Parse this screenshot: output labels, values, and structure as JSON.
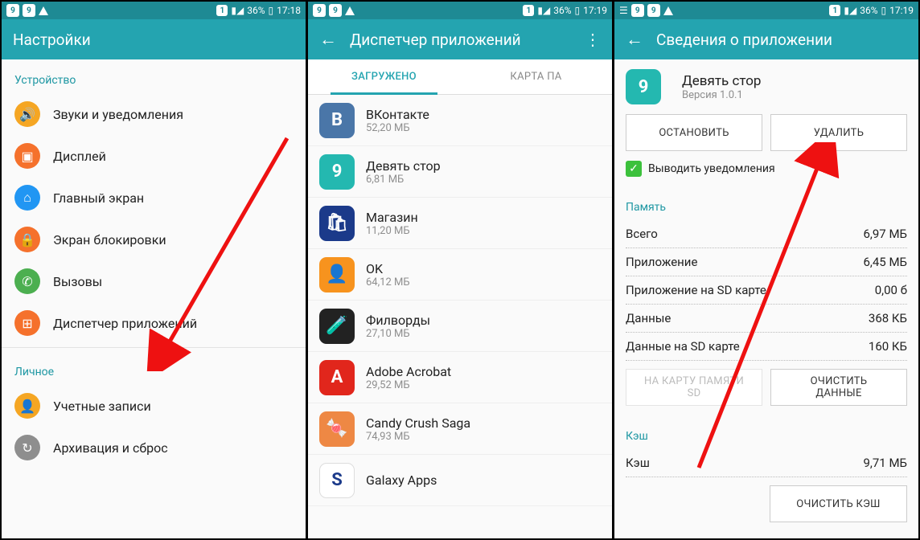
{
  "statusbar": {
    "battery": "36%",
    "time1": "17:18",
    "time2": "17:19",
    "time3": "17:19",
    "sim_badge": "1"
  },
  "screen1": {
    "title": "Настройки",
    "section_device": "Устройство",
    "items_device": [
      {
        "label": "Звуки и уведомления",
        "color": "#f5a623",
        "glyph": "🔊"
      },
      {
        "label": "Дисплей",
        "color": "#f5712c",
        "glyph": "▣"
      },
      {
        "label": "Главный экран",
        "color": "#2196f3",
        "glyph": "⌂"
      },
      {
        "label": "Экран блокировки",
        "color": "#f5712c",
        "glyph": "🔒"
      },
      {
        "label": "Вызовы",
        "color": "#4caf50",
        "glyph": "✆"
      },
      {
        "label": "Диспетчер приложений",
        "color": "#f5712c",
        "glyph": "⊞"
      }
    ],
    "section_personal": "Личное",
    "items_personal": [
      {
        "label": "Учетные записи",
        "color": "#f5a623",
        "glyph": "👤"
      },
      {
        "label": "Архивация и сброс",
        "color": "#8e8e8e",
        "glyph": "↻"
      }
    ]
  },
  "screen2": {
    "title": "Диспетчер приложений",
    "tab_downloaded": "ЗАГРУЖЕНО",
    "tab_sd": "КАРТА ПА",
    "apps": [
      {
        "name": "ВКонтакте",
        "size": "52,20 МБ",
        "bg": "#4a76a8",
        "glyph": "В"
      },
      {
        "name": "Девять стор",
        "size": "6,81 МБ",
        "bg": "#24b8b0",
        "glyph": "9"
      },
      {
        "name": "Магазин",
        "size": "11,20 МБ",
        "bg": "#1b3a8a",
        "glyph": "🛍"
      },
      {
        "name": "OK",
        "size": "64,12 МБ",
        "bg": "#f7931e",
        "glyph": "👤"
      },
      {
        "name": "Филворды",
        "size": "27,10 МБ",
        "bg": "#222",
        "glyph": "🧪"
      },
      {
        "name": "Adobe Acrobat",
        "size": "29,52 МБ",
        "bg": "#e1261c",
        "glyph": "A"
      },
      {
        "name": "Candy Crush Saga",
        "size": "74,93 МБ",
        "bg": "#e84",
        "glyph": "🍬"
      },
      {
        "name": "Galaxy Apps",
        "size": "",
        "bg": "#fff",
        "glyph": "S"
      }
    ]
  },
  "screen3": {
    "title": "Сведения о приложении",
    "app_name": "Девять стор",
    "app_version": "Версия 1.0.1",
    "btn_stop": "ОСТАНОВИТЬ",
    "btn_uninstall": "УДАЛИТЬ",
    "check_label": "Выводить уведомления",
    "section_memory": "Память",
    "memory": [
      {
        "k": "Всего",
        "v": "6,97 МБ"
      },
      {
        "k": "Приложение",
        "v": "6,45 МБ"
      },
      {
        "k": "Приложение на SD карте",
        "v": "0,00 б"
      },
      {
        "k": "Данные",
        "v": "368 КБ"
      },
      {
        "k": "Данные на SD карте",
        "v": "160 КБ"
      }
    ],
    "btn_move_sd_l1": "НА КАРТУ ПАМЯТИ",
    "btn_move_sd_l2": "SD",
    "btn_clear_data_l1": "ОЧИСТИТЬ",
    "btn_clear_data_l2": "ДАННЫЕ",
    "section_cache": "Кэш",
    "cache_label": "Кэш",
    "cache_value": "9,71 МБ",
    "btn_clear_cache": "ОЧИСТИТЬ КЭШ"
  }
}
